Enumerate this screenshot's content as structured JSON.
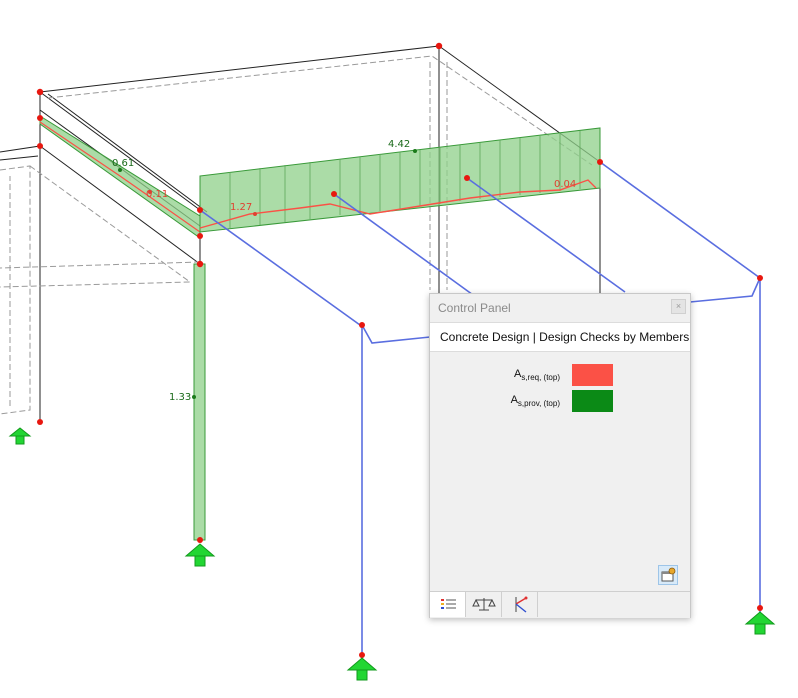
{
  "model_labels": {
    "beam_left_value": "0.61",
    "beam_left_red": "0.11",
    "column_value": "1.33",
    "beam_front_top": "4.42",
    "beam_front_red_left": "1.27",
    "beam_front_red_right": "0.04"
  },
  "colors": {
    "required_reinforcement": "#fb5146",
    "provided_reinforcement": "#0b8a16",
    "member_line": "#5a6ee0",
    "node": "#e8170f",
    "support": "#22d633"
  },
  "control_panel": {
    "title": "Control Panel",
    "close_label": "×",
    "header": "Concrete Design | Design Checks by Members",
    "legend": [
      {
        "main": "A",
        "sub": "s,req, (top)",
        "color": "#fb5146"
      },
      {
        "main": "A",
        "sub": "s,prov, (top)",
        "color": "#0b8a16"
      }
    ],
    "tabs": [
      {
        "name": "color-scales-icon",
        "active": true
      },
      {
        "name": "balance-icon",
        "active": false
      },
      {
        "name": "result-diagram-icon",
        "active": false
      }
    ]
  }
}
